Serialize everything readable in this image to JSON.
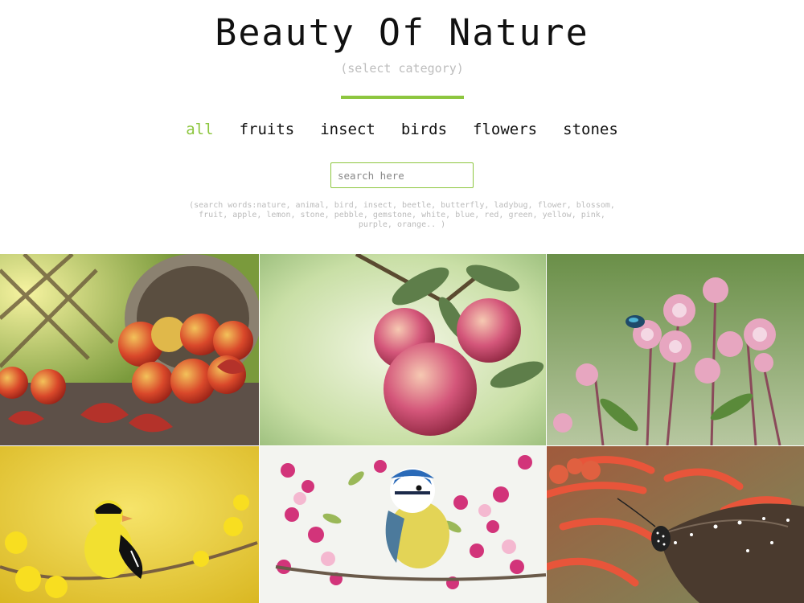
{
  "header": {
    "title": "Beauty Of Nature",
    "subtitle": "(select category)"
  },
  "nav": {
    "tabs": [
      {
        "label": "all",
        "active": true
      },
      {
        "label": "fruits",
        "active": false
      },
      {
        "label": "insect",
        "active": false
      },
      {
        "label": "birds",
        "active": false
      },
      {
        "label": "flowers",
        "active": false
      },
      {
        "label": "stones",
        "active": false
      }
    ]
  },
  "search": {
    "placeholder": "search here",
    "value": ""
  },
  "hint": "(search words:nature, animal, bird, insect, beetle, butterfly, ladybug, flower, blossom, fruit, apple, lemon, stone, pebble, gemstone, white, blue, red, green, yellow, pink, purple, orange.. )",
  "colors": {
    "accent": "#8dc63f",
    "muted_text": "#bdbdbd"
  },
  "gallery": {
    "items": [
      {
        "subject": "apples-in-basket",
        "category": "fruits"
      },
      {
        "subject": "apples-on-branch",
        "category": "fruits"
      },
      {
        "subject": "beetle-on-flowers",
        "category": "insect"
      },
      {
        "subject": "goldfinch-on-branch",
        "category": "birds"
      },
      {
        "subject": "blue-tit-in-blossoms",
        "category": "birds"
      },
      {
        "subject": "butterfly-on-red-flowers",
        "category": "insect"
      }
    ]
  }
}
